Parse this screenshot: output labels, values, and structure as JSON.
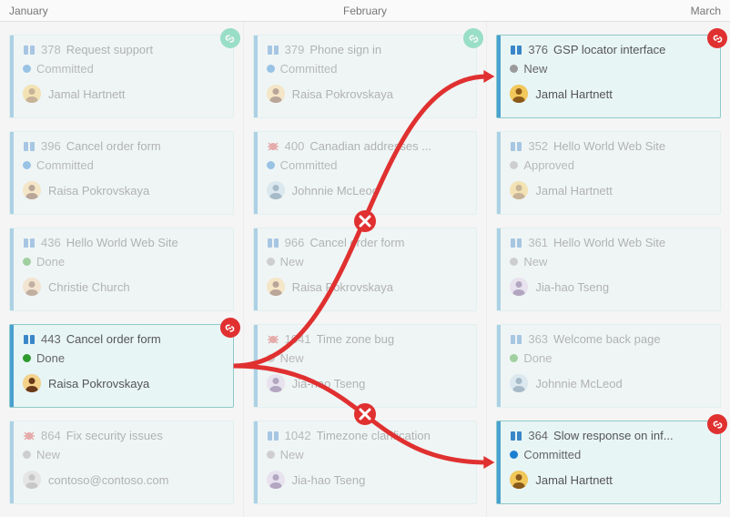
{
  "months": [
    "January",
    "February",
    "March"
  ],
  "stateColors": {
    "Committed": "#1d7fd0",
    "Done": "#2d9b2d",
    "New": "#9a9a9a",
    "Approved": "#9a9a9a"
  },
  "typeColors": {
    "feature": "#3a86c8",
    "bug": "#d04646"
  },
  "avatars": {
    "Jamal Hartnett": {
      "bg": "#f2c85b",
      "fg": "#8a5a1a"
    },
    "Raisa Pokrovskaya": {
      "bg": "#f4d28a",
      "fg": "#6a3a1a"
    },
    "Christie Church": {
      "bg": "#eecfa0",
      "fg": "#7a5030"
    },
    "Johnnie McLeod": {
      "bg": "#b8d8e8",
      "fg": "#3a6a8a"
    },
    "Jia-hao Tseng": {
      "bg": "#d8c8e8",
      "fg": "#5a3a7a"
    },
    "contoso@contoso.com": {
      "bg": "#d0d0d0",
      "fg": "#888"
    }
  },
  "columns": [
    [
      {
        "id": "c1a",
        "type": "feature",
        "wid": "378",
        "title": "Request support",
        "state": "Committed",
        "assignee": "Jamal Hartnett",
        "dim": true,
        "badge": "green"
      },
      {
        "id": "c1b",
        "type": "feature",
        "wid": "396",
        "title": "Cancel order form",
        "state": "Committed",
        "assignee": "Raisa Pokrovskaya",
        "dim": true
      },
      {
        "id": "c1c",
        "type": "feature",
        "wid": "436",
        "title": "Hello World Web Site",
        "state": "Done",
        "assignee": "Christie Church",
        "dim": true
      },
      {
        "id": "c1d",
        "type": "feature",
        "wid": "443",
        "title": "Cancel order form",
        "state": "Done",
        "assignee": "Raisa Pokrovskaya",
        "dim": false,
        "badge": "red"
      },
      {
        "id": "c1e",
        "type": "bug",
        "wid": "864",
        "title": "Fix security issues",
        "state": "New",
        "assignee": "contoso@contoso.com",
        "dim": true
      }
    ],
    [
      {
        "id": "c2a",
        "type": "feature",
        "wid": "379",
        "title": "Phone sign in",
        "state": "Committed",
        "assignee": "Raisa Pokrovskaya",
        "dim": true,
        "badge": "green"
      },
      {
        "id": "c2b",
        "type": "bug",
        "wid": "400",
        "title": "Canadian addresses ...",
        "state": "Committed",
        "assignee": "Johnnie McLeod",
        "dim": true
      },
      {
        "id": "c2c",
        "type": "feature",
        "wid": "966",
        "title": "Cancel order form",
        "state": "New",
        "assignee": "Raisa Pokrovskaya",
        "dim": true
      },
      {
        "id": "c2d",
        "type": "bug",
        "wid": "1041",
        "title": "Time zone bug",
        "state": "New",
        "assignee": "Jia-hao Tseng",
        "dim": true
      },
      {
        "id": "c2e",
        "type": "feature",
        "wid": "1042",
        "title": "Timezone clarification",
        "state": "New",
        "assignee": "Jia-hao Tseng",
        "dim": true
      }
    ],
    [
      {
        "id": "c3a",
        "type": "feature",
        "wid": "376",
        "title": "GSP locator interface",
        "state": "New",
        "assignee": "Jamal Hartnett",
        "dim": false,
        "badge": "red"
      },
      {
        "id": "c3b",
        "type": "feature",
        "wid": "352",
        "title": "Hello World Web Site",
        "state": "Approved",
        "assignee": "Jamal Hartnett",
        "dim": true
      },
      {
        "id": "c3c",
        "type": "feature",
        "wid": "361",
        "title": "Hello World Web Site",
        "state": "New",
        "assignee": "Jia-hao Tseng",
        "dim": true
      },
      {
        "id": "c3d",
        "type": "feature",
        "wid": "363",
        "title": "Welcome back page",
        "state": "Done",
        "assignee": "Johnnie McLeod",
        "dim": true
      },
      {
        "id": "c3e",
        "type": "feature",
        "wid": "364",
        "title": "Slow response on inf...",
        "state": "Committed",
        "assignee": "Jamal Hartnett",
        "dim": false,
        "badge": "red"
      }
    ]
  ],
  "connections": [
    {
      "from": "c1d",
      "to": "c3a",
      "broken": true
    },
    {
      "from": "c1d",
      "to": "c3e",
      "broken": true
    }
  ]
}
